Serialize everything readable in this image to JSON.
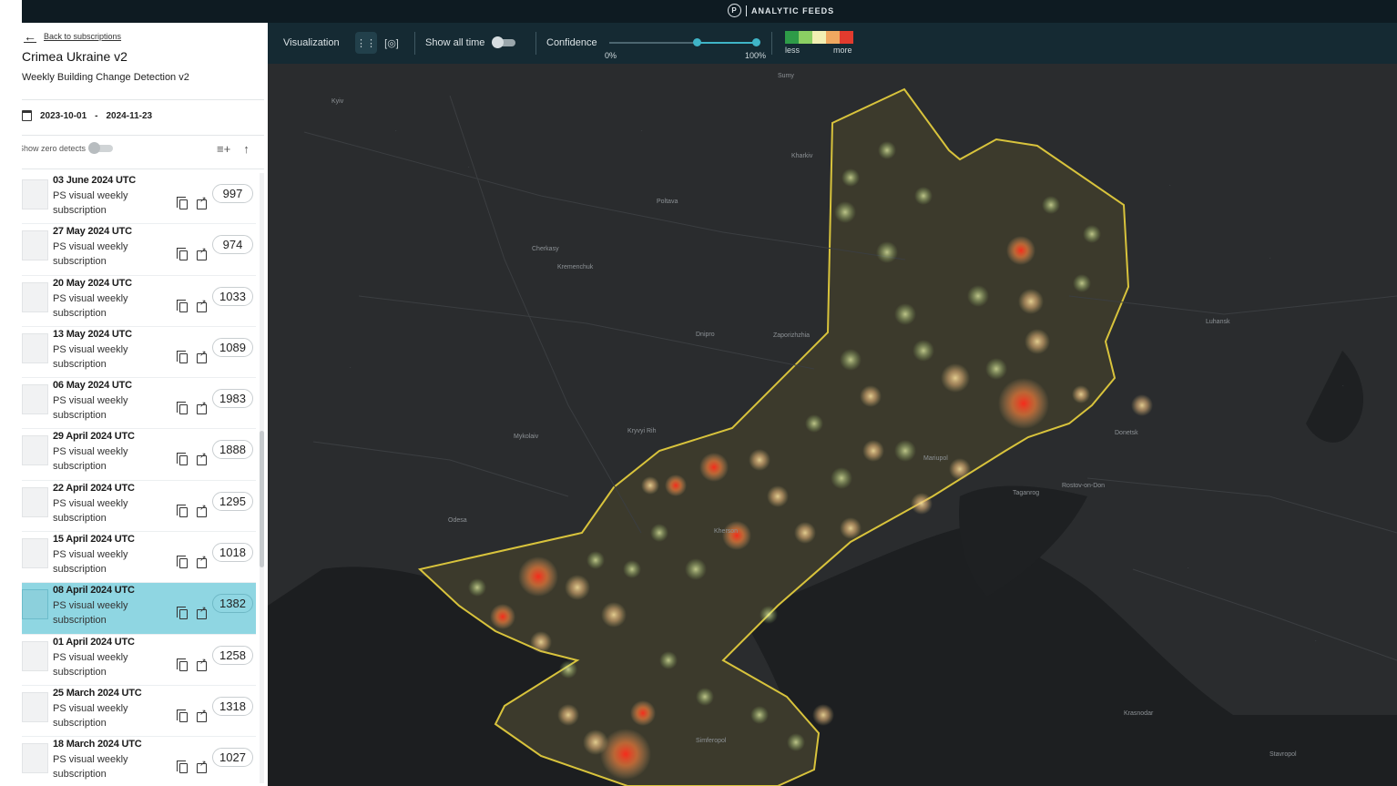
{
  "header": {
    "brand_logo": "P",
    "brand": "ANALYTIC FEEDS"
  },
  "sidebar": {
    "back_label": "Back to subscriptions",
    "title": "Crimea Ukraine v2",
    "description": "Weekly Building Change Detection v2",
    "date_start": "2023-10-01",
    "date_sep": "-",
    "date_end": "2024-11-23",
    "zero_detects_label": "Show zero detects",
    "items": [
      {
        "date": "03 June 2024 UTC",
        "line1": "PS visual weekly",
        "line2": "subscription",
        "count": "997",
        "selected": false
      },
      {
        "date": "27 May 2024 UTC",
        "line1": "PS visual weekly",
        "line2": "subscription",
        "count": "974",
        "selected": false
      },
      {
        "date": "20 May 2024 UTC",
        "line1": "PS visual weekly",
        "line2": "subscription",
        "count": "1033",
        "selected": false
      },
      {
        "date": "13 May 2024 UTC",
        "line1": "PS visual weekly",
        "line2": "subscription",
        "count": "1089",
        "selected": false
      },
      {
        "date": "06 May 2024 UTC",
        "line1": "PS visual weekly",
        "line2": "subscription",
        "count": "1983",
        "selected": false
      },
      {
        "date": "29 April 2024 UTC",
        "line1": "PS visual weekly",
        "line2": "subscription",
        "count": "1888",
        "selected": false
      },
      {
        "date": "22 April 2024 UTC",
        "line1": "PS visual weekly",
        "line2": "subscription",
        "count": "1295",
        "selected": false
      },
      {
        "date": "15 April 2024 UTC",
        "line1": "PS visual weekly",
        "line2": "subscription",
        "count": "1018",
        "selected": false
      },
      {
        "date": "08 April 2024 UTC",
        "line1": "PS visual weekly",
        "line2": "subscription",
        "count": "1382",
        "selected": true
      },
      {
        "date": "01 April 2024 UTC",
        "line1": "PS visual weekly",
        "line2": "subscription",
        "count": "1258",
        "selected": false
      },
      {
        "date": "25 March 2024 UTC",
        "line1": "PS visual weekly",
        "line2": "subscription",
        "count": "1318",
        "selected": false
      },
      {
        "date": "18 March 2024 UTC",
        "line1": "PS visual weekly",
        "line2": "subscription",
        "count": "1027",
        "selected": false
      }
    ]
  },
  "toolbar": {
    "visualization_label": "Visualization",
    "show_all_time_label": "Show all time",
    "confidence_label": "Confidence",
    "confidence_min": "0%",
    "confidence_max": "100%",
    "confidence_low": 0.59,
    "confidence_high": 1.0,
    "legend_less": "less",
    "legend_more": "more",
    "legend_colors": [
      "#2e9b48",
      "#8bcf63",
      "#f2efb3",
      "#f0a860",
      "#e23b2e"
    ]
  },
  "colors": {
    "selected_row": "#8fd6e2",
    "aoi_outline": "#d6c23d",
    "accent": "#3fb4c7"
  },
  "map": {
    "labels": [
      "Kyiv",
      "Kharkiv",
      "Dnipro",
      "Kremenchuk",
      "Mykolaiv",
      "Odesa",
      "Rostov-on-Don",
      "Zaporizhzhia",
      "Mariupol",
      "Taganrog",
      "Poltava",
      "Cherkasy",
      "Kryvyi Rih",
      "Kherson",
      "Simferopol",
      "Donetsk",
      "Luhansk",
      "Krasnodar",
      "Stavropol",
      "Sumy"
    ]
  }
}
